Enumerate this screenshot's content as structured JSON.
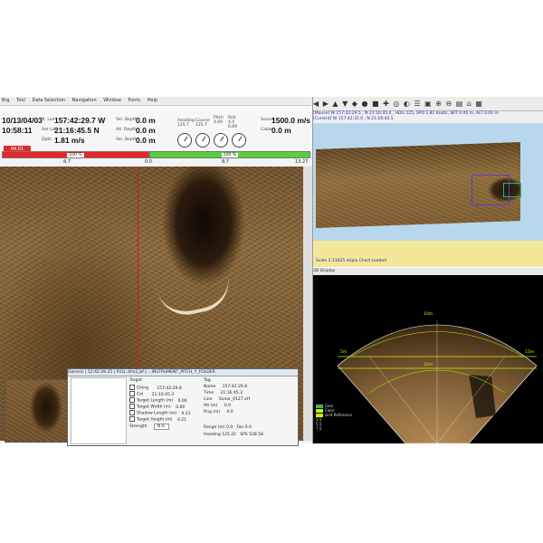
{
  "left_window": {
    "menu": [
      "Brg",
      "Tool",
      "Data Selection",
      "Navigation",
      "Window",
      "Fonts",
      "Help"
    ],
    "date": "10/13/04/03",
    "time": "10:58:11",
    "latitude": "157:42:29.7 W",
    "longitude": "21:16:45.5 N",
    "depth": "1.81 m/s",
    "depth_label": "Dpth",
    "lat_label": "Tr. Lon",
    "lon_label": "Set Lat",
    "pings": [
      {
        "label": "Vol. Depth",
        "value": "0.0 m"
      },
      {
        "label": "Alt. Depth",
        "value": "0.0 m"
      },
      {
        "label": "Vol. Depth",
        "value": "0.0 m"
      }
    ],
    "gauges": [
      {
        "label": "Heading",
        "value": "125.7"
      },
      {
        "label": "Course",
        "value": "125.7"
      },
      {
        "label": "Pitch",
        "value": "4.69"
      },
      {
        "label": "Roll",
        "value": "4.4"
      }
    ],
    "gauge_extra": "6.69",
    "sound_speed_label": "Sound",
    "sound_speed": "1500.0 m/s",
    "cable_label": "Cable",
    "cable": "0.0 m",
    "red_chip": "04.01",
    "bar_labels": [
      "100 %",
      "100 %"
    ],
    "ticks": [
      "8.7",
      "0.0",
      "8.7",
      "13.27"
    ]
  },
  "dialog": {
    "title": "Generic | 12:42:29.25 | FULL.stm2.jsf | ...INSTRUMENT_PITCH_Y_FOLDER",
    "target_group": "Target",
    "fields_left": [
      {
        "label": "Ching",
        "value": "157:42:29.8"
      },
      {
        "label": "Col",
        "value": "21:16:45.3"
      },
      {
        "label": "Target Length (m)",
        "value": "0.00"
      },
      {
        "label": "Target Width (m)",
        "value": "0.00"
      },
      {
        "label": "Shadow Length (m)",
        "value": "0.21"
      },
      {
        "label": "Target Height (m)",
        "value": "0.21"
      }
    ],
    "strength_label": "Strength",
    "strength_value": "N.A.",
    "right_group": "Tag",
    "fields_right": [
      {
        "label": "Name",
        "value": "157:42:29.8"
      },
      {
        "label": "Time",
        "value": "21:16:45.3"
      },
      {
        "label": "Line",
        "value": "Sonar_0127.xtf"
      },
      {
        "label": "Alt (m)",
        "value": "0.0"
      },
      {
        "label": "Rng (m)",
        "value": "0.0"
      }
    ],
    "footer": [
      {
        "label": "Range (m)",
        "value": "0.0"
      },
      {
        "label": "Fan",
        "value": "0.0"
      },
      {
        "label": "Heading",
        "value": "125.22"
      },
      {
        "label": "SPS",
        "value": "528.58"
      }
    ]
  },
  "right_top": {
    "toolbar_glyphs": "◀ ▶ ▲ ▼ ◆ ● ■ ✚ ◎ ◐ ☰ ▣ ⊕ ⊖ ▤ ⌂ ▦",
    "info_line_1": "[Mouse] W 157:42:29.5 , N 21:16:45.0 , HDG 125, SPD 1.81 Knots, SRT 0.00 m, ALT 0.00 m",
    "info_line_2": "[Current] W 157:42:31.0 , N 21:16:45.5",
    "scale": "Scale 1:11625 m/pix Chart Loaded"
  },
  "right_bottom": {
    "title": "3D Display",
    "range_labels": [
      "5m",
      "10m",
      "15m",
      "20m"
    ],
    "legend": [
      {
        "label": "Gain",
        "color": "#3cb371"
      },
      {
        "label": "Color",
        "color": "#c8f000"
      },
      {
        "label": "Grid Reference",
        "color": "#c8f000"
      }
    ],
    "legend_nums": [
      "3.5",
      "5.5",
      "7.5"
    ],
    "accent": "#c8f000"
  }
}
